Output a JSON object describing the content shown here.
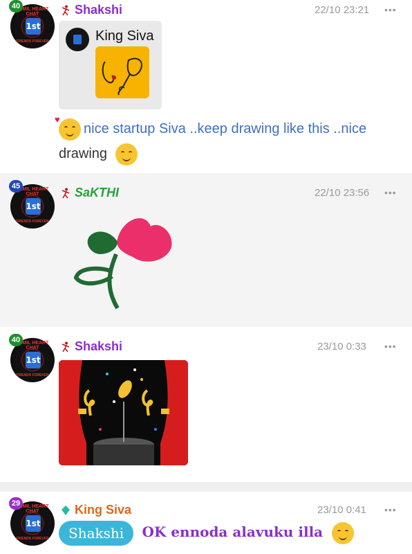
{
  "messages": [
    {
      "badge": "40",
      "badge_color": "#1e8f2d",
      "name": "Shakshi",
      "name_color": "#8b2fc9",
      "time": "22/10 23:21",
      "more": "•••",
      "quote": {
        "name": "King Siva"
      },
      "text_a": "nice startup Siva ..keep drawing like this ..nice",
      "text_b": "drawing"
    },
    {
      "badge": "45",
      "badge_color": "#2346b8",
      "name": "SaKTHI",
      "name_color": "#27a23a",
      "time": "22/10 23:56",
      "more": "•••"
    },
    {
      "badge": "40",
      "badge_color": "#1e8f2d",
      "name": "Shakshi",
      "name_color": "#8b2fc9",
      "time": "23/10 0:33",
      "more": "•••"
    },
    {
      "badge": "29",
      "badge_color": "#9b2fc9",
      "name": "King Siva",
      "name_color": "#e0661f",
      "time": "23/10 0:41",
      "more": "•••",
      "chip": "Shakshi",
      "text": "OK ennoda alavuku illa"
    }
  ],
  "avatar_text": {
    "top": "TAMIL HEART CHAT",
    "center": "1st",
    "bottom": "FRIENDS FOREVER"
  },
  "icons": [
    "dancer-icon",
    "gem-icon",
    "smiling-face-with-hearts-emoji",
    "smiling-blush-emoji",
    "laughing-tears-emoji"
  ]
}
